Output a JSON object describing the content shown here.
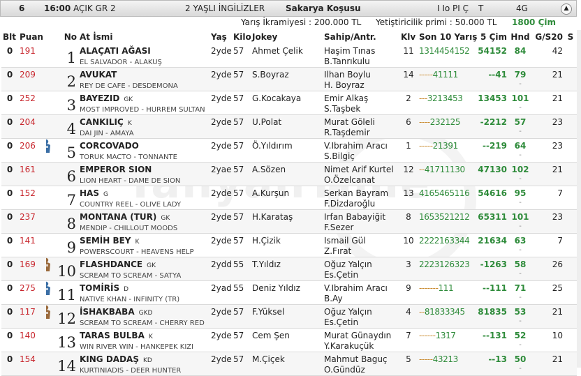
{
  "race": {
    "no": "6",
    "time": "16:00",
    "type": "AÇIK GR 2",
    "age_group": "2 YAŞLI İNGİLİZLER",
    "name": "Sakarya Koşusu",
    "conds": "I Io PI Ç",
    "surface": "T",
    "group": "4G",
    "prize": "Yarış İkramiyesi : 200.000 TL",
    "breeder_prize": "Yetiştiricilik primi : 50.000 TL",
    "distance": "1800 Çim",
    "collapse_icon": "chevron-up-icon"
  },
  "columns": {
    "blt": "Blt",
    "puan": "Puan",
    "no": "No",
    "at": "At İsmi",
    "yas": "Yaş",
    "kilo": "Kilo",
    "jokey": "Jokey",
    "sahip": "Sahip/Antr.",
    "klv": "Klv",
    "son10": "Son 10 Yarış",
    "cim5": "5 Çim",
    "hnd": "Hnd",
    "g": "G/S20",
    "s": "S"
  },
  "horses": [
    {
      "blt": "0",
      "puan": "191",
      "no": "1",
      "icon": "",
      "name": "ALAÇATI AĞASI",
      "tag": "",
      "pedigree": "EL SALVADOR - ALAKUŞ",
      "age": "2yde",
      "kilo": "57",
      "jockey": "Ahmet Çelik",
      "owner": "Haşim Tınas",
      "trainer": "B.Tanrıkulu",
      "klv": "11",
      "last10_pre": "",
      "last10": "1314454152",
      "best": "54152",
      "hnd": "84",
      "hnd2": "",
      "g": "",
      "s20": "42"
    },
    {
      "blt": "0",
      "puan": "209",
      "no": "2",
      "icon": "",
      "name": "AVUKAT",
      "tag": "",
      "pedigree": "REY DE CAFE - DESDEMONA",
      "age": "2yde",
      "kilo": "57",
      "jockey": "S.Boyraz",
      "owner": "Ilhan Boylu",
      "trainer": "H. Boyraz",
      "klv": "14",
      "last10_pre": "-----",
      "last10": "41111",
      "best": "--41",
      "hnd": "79",
      "hnd2": "-",
      "g": "",
      "s20": "21"
    },
    {
      "blt": "0",
      "puan": "252",
      "no": "3",
      "icon": "",
      "name": "BAYEZID",
      "tag": "GK",
      "pedigree": "MOST IMPROVED - HURREM SULTAN",
      "age": "2yde",
      "kilo": "57",
      "jockey": "G.Kocakaya",
      "owner": "Emir Alkaş",
      "trainer": "S.Taşbek",
      "klv": "2",
      "last10_pre": "---",
      "last10": "3213453",
      "best": "13453",
      "hnd": "101",
      "hnd2": "-",
      "g": "",
      "s20": "21"
    },
    {
      "blt": "0",
      "puan": "204",
      "no": "4",
      "icon": "",
      "name": "CANKILIÇ",
      "tag": "K",
      "pedigree": "DAI JIN - AMAYA",
      "age": "2yde",
      "kilo": "57",
      "jockey": "U.Polat",
      "owner": "Murat Göleli",
      "trainer": "R.Taşdemir",
      "klv": "6",
      "last10_pre": "----",
      "last10": "232125",
      "best": "-2212",
      "hnd": "57",
      "hnd2": "-",
      "g": "",
      "s20": "23"
    },
    {
      "blt": "0",
      "puan": "206",
      "no": "5",
      "icon": "jockey-silk-blue-icon",
      "name": "CORCOVADO",
      "tag": "",
      "pedigree": "TORUK MACTO - TONNANTE",
      "age": "2yde",
      "kilo": "57",
      "jockey": "Ö.Yıldırım",
      "owner": "V.Ibrahim Aracı",
      "trainer": "S.Bilgiç",
      "klv": "1",
      "last10_pre": "-----",
      "last10": "21391",
      "best": "--219",
      "hnd": "64",
      "hnd2": "-",
      "g": "",
      "s20": "23"
    },
    {
      "blt": "0",
      "puan": "161",
      "no": "6",
      "icon": "",
      "name": "EMPEROR SION",
      "tag": "",
      "pedigree": "LION HEART - DAME DE SION",
      "age": "2yae",
      "kilo": "57",
      "jockey": "A.Sözen",
      "owner": "Nimet Arif Kurtel",
      "trainer": "O.Özelcanat",
      "klv": "12",
      "last10_pre": "--",
      "last10": "41711130",
      "best": "47130",
      "hnd": "102",
      "hnd2": "-",
      "g": "",
      "s20": "21"
    },
    {
      "blt": "0",
      "puan": "152",
      "no": "7",
      "icon": "",
      "name": "HAS",
      "tag": "G",
      "pedigree": "COUNTRY REEL - OLIVE LADY",
      "age": "2yde",
      "kilo": "57",
      "jockey": "A.Kurşun",
      "owner": "Serkan Bayram",
      "trainer": "F.Dizdaroğlu",
      "klv": "13",
      "last10_pre": "",
      "last10": "4165465116",
      "best": "54616",
      "hnd": "95",
      "hnd2": "-",
      "g": "",
      "s20": "7"
    },
    {
      "blt": "0",
      "puan": "237",
      "no": "8",
      "icon": "",
      "name": "MONTANA (TUR)",
      "tag": "GK",
      "pedigree": "MENDIP - CHILLOUT MOODS",
      "age": "2yde",
      "kilo": "57",
      "jockey": "H.Karataş",
      "owner": "Irfan Babayiğit",
      "trainer": "F.Sezer",
      "klv": "8",
      "last10_pre": "",
      "last10": "1653521212",
      "best": "65311",
      "hnd": "101",
      "hnd2": "-",
      "g": "",
      "s20": "23"
    },
    {
      "blt": "0",
      "puan": "141",
      "no": "9",
      "icon": "",
      "name": "SEMİH BEY",
      "tag": "K",
      "pedigree": "POWERSCOURT - HEAVENS HELP",
      "age": "2yde",
      "kilo": "57",
      "jockey": "H.Çizik",
      "owner": "Ismail Gül",
      "trainer": "Z.Fırat",
      "klv": "10",
      "last10_pre": "",
      "last10": "2222163344",
      "best": "21634",
      "hnd": "63",
      "hnd2": "-",
      "g": "",
      "s20": "7"
    },
    {
      "blt": "0",
      "puan": "169",
      "no": "10",
      "icon": "jockey-silk-brown-icon",
      "name": "FLASHDANCE",
      "tag": "GK",
      "pedigree": "SCREAM TO SCREAM - SATYA",
      "age": "2ydd",
      "kilo": "55",
      "jockey": "T.Yıldız",
      "owner": "Oğuz Yalçın",
      "trainer": "Es.Çetin",
      "klv": "3",
      "last10_pre": "",
      "last10": "2223126323",
      "best": "-1263",
      "hnd": "58",
      "hnd2": "-",
      "g": "",
      "s20": "26"
    },
    {
      "blt": "0",
      "puan": "275",
      "no": "11",
      "icon": "jockey-silk-blue-icon",
      "name": "TOMİRİS",
      "tag": "D",
      "pedigree": "NATIVE KHAN - INFINITY (TR)",
      "age": "2yad",
      "kilo": "55",
      "jockey": "Deniz Yıldız",
      "owner": "V.Ibrahim Aracı",
      "trainer": "B.Ay",
      "klv": "9",
      "last10_pre": "-------",
      "last10": "111",
      "best": "--111",
      "hnd": "71",
      "hnd2": "-",
      "g": "",
      "s20": "25"
    },
    {
      "blt": "0",
      "puan": "117",
      "no": "12",
      "icon": "jockey-silk-brown-icon",
      "name": "İSHAKBABA",
      "tag": "GKD",
      "pedigree": "SCREAM TO SCREAM - CHERRY RED",
      "age": "2yde",
      "kilo": "57",
      "jockey": "F.Yüksel",
      "owner": "Oğuz Yalçın",
      "trainer": "Es.Çetin",
      "klv": "4",
      "last10_pre": "--",
      "last10": "81833345",
      "best": "81835",
      "hnd": "53",
      "hnd2": "-",
      "g": "",
      "s20": "21"
    },
    {
      "blt": "0",
      "puan": "140",
      "no": "13",
      "icon": "",
      "name": "TARAS BULBA",
      "tag": "K",
      "pedigree": "WIN RIVER WIN - HANKEPEK KIZI",
      "age": "2yde",
      "kilo": "57",
      "jockey": "Cem Şen",
      "owner": "Murat Günaydın",
      "trainer": "Y.Karakuçük",
      "klv": "7",
      "last10_pre": "------",
      "last10": "1317",
      "best": "--131",
      "hnd": "52",
      "hnd2": "-",
      "g": "",
      "s20": "10"
    },
    {
      "blt": "0",
      "puan": "154",
      "no": "14",
      "icon": "",
      "name": "KING DADAŞ",
      "tag": "KD",
      "pedigree": "KURTINIADIS - DEER HUNTER",
      "age": "2yde",
      "kilo": "57",
      "jockey": "M.Çiçek",
      "owner": "Mahmut Baguç",
      "trainer": "O.Gündüz",
      "klv": "5",
      "last10_pre": "-----",
      "last10": "43213",
      "best": "--13",
      "hnd": "50",
      "hnd2": "-",
      "g": "",
      "s20": "21"
    }
  ]
}
